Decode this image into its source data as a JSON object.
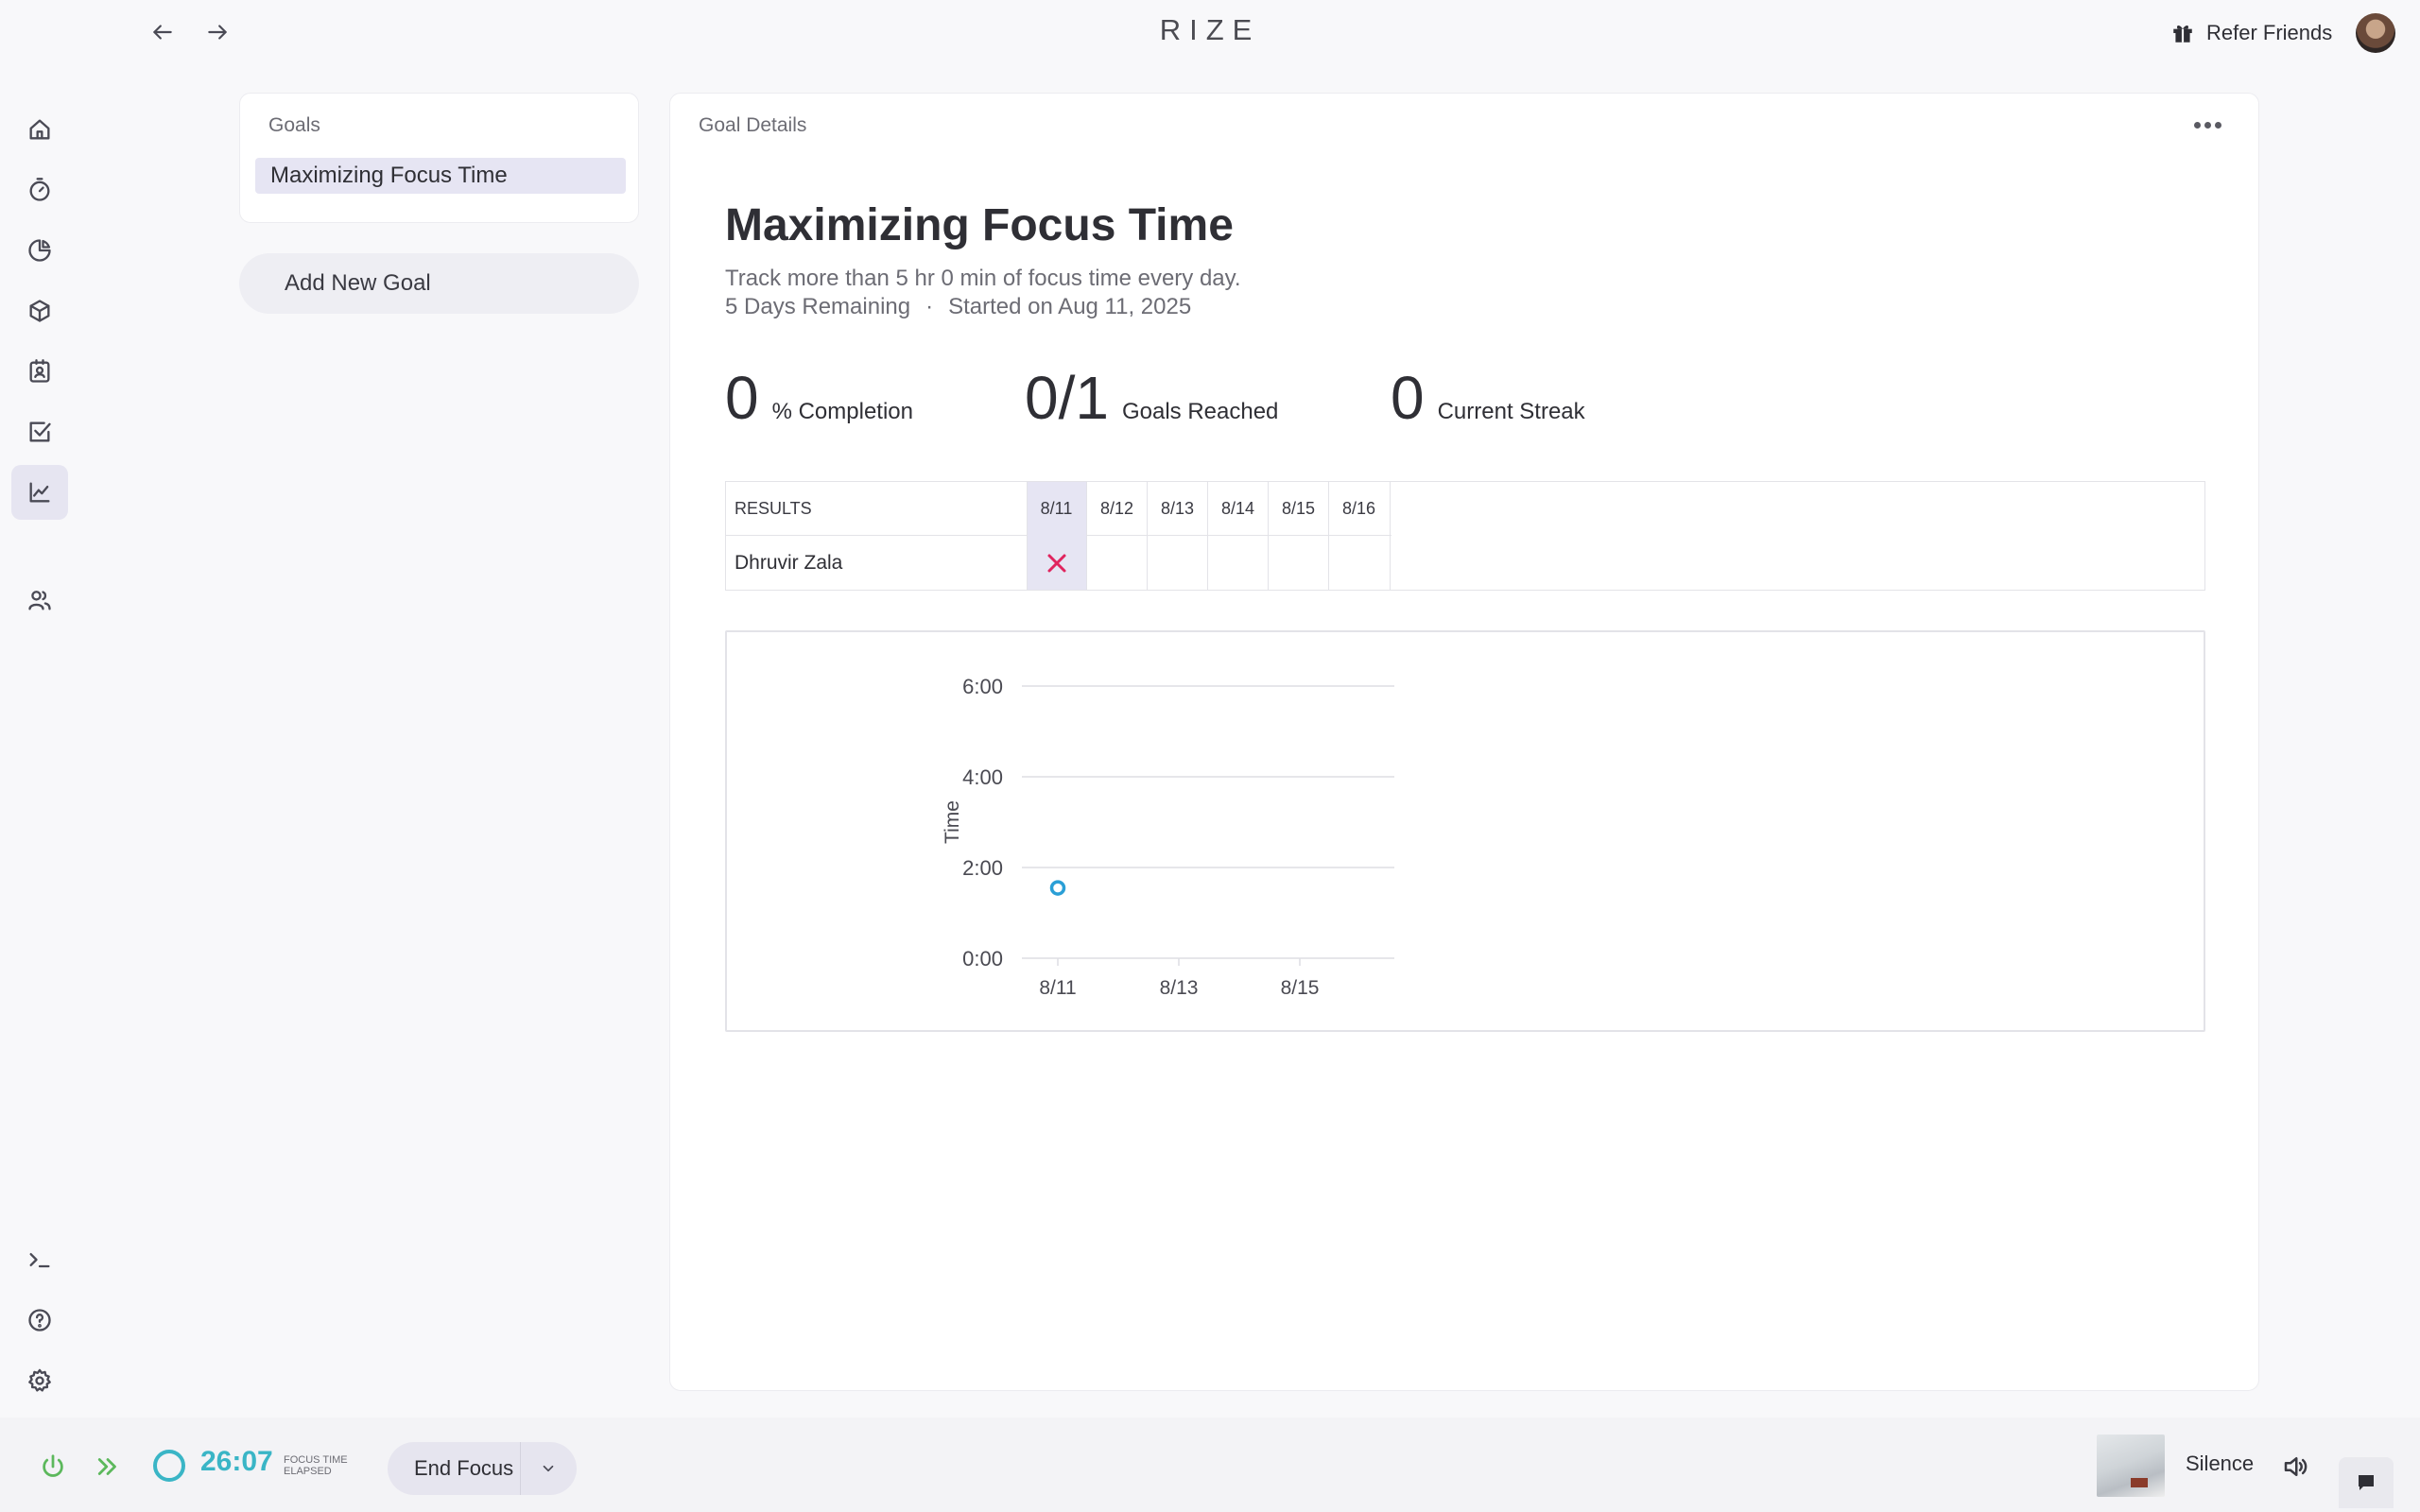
{
  "app": {
    "logo": "RIZE",
    "refer_label": "Refer Friends"
  },
  "icons": {
    "back": "arrow-left-icon",
    "forward": "arrow-right-icon",
    "gift": "gift-icon",
    "sidebar": [
      "home-icon",
      "timer-icon",
      "pie-chart-icon",
      "cube-icon",
      "contact-card-icon",
      "checkbox-icon",
      "line-chart-icon",
      "users-icon",
      "terminal-icon",
      "help-icon",
      "settings-icon"
    ]
  },
  "goals": {
    "header": "Goals",
    "items": [
      {
        "label": "Maximizing Focus Time",
        "selected": true
      }
    ],
    "add_label": "Add New Goal"
  },
  "details": {
    "header": "Goal Details",
    "title": "Maximizing Focus Time",
    "description": "Track more than 5 hr 0 min of focus time every day.",
    "days_remaining": "5 Days Remaining",
    "separator": "·",
    "started": "Started on Aug 11, 2025",
    "stats": [
      {
        "value": "0",
        "label": "% Completion"
      },
      {
        "value": "0/1",
        "label": "Goals Reached"
      },
      {
        "value": "0",
        "label": "Current Streak"
      }
    ],
    "results": {
      "header": "RESULTS",
      "dates": [
        "8/11",
        "8/12",
        "8/13",
        "8/14",
        "8/15",
        "8/16"
      ],
      "current_date": "8/11",
      "rows": [
        {
          "name": "Dhruvir Zala",
          "marks": [
            "missed",
            "",
            "",
            "",
            "",
            ""
          ]
        }
      ]
    }
  },
  "chart_data": {
    "type": "scatter",
    "ylabel": "Time",
    "yticks": [
      "0:00",
      "2:00",
      "4:00",
      "6:00"
    ],
    "ylim": [
      0,
      6
    ],
    "xticks": [
      "8/11",
      "8/13",
      "8/15"
    ],
    "x_categories": [
      "8/11",
      "8/12",
      "8/13",
      "8/14",
      "8/15",
      "8/16"
    ],
    "points": [
      {
        "x": "8/11",
        "y": 1.55
      }
    ],
    "grid": true,
    "point_color": "#2a9fd6"
  },
  "bottombar": {
    "timer": "26:07",
    "timer_label": "FOCUS TIME ELAPSED",
    "end_focus_label": "End Focus",
    "sound_label": "Silence",
    "accent": "#3ab5c6",
    "power_color": "#5cb85c"
  }
}
